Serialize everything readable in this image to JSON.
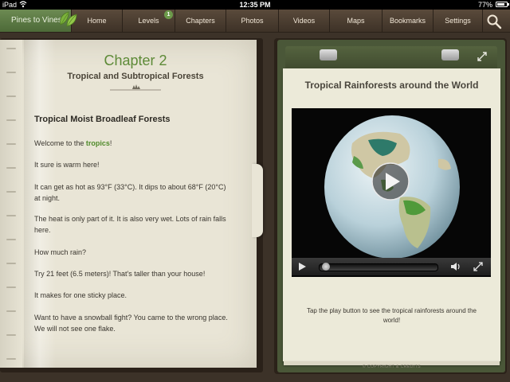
{
  "status": {
    "device": "iPad",
    "time": "12:35 PM",
    "battery": "77%",
    "battery_level": 0.77
  },
  "nav": {
    "brand": "Pines to Vines",
    "items": [
      {
        "label": "Home"
      },
      {
        "label": "Levels",
        "badge": "1"
      },
      {
        "label": "Chapters"
      },
      {
        "label": "Photos"
      },
      {
        "label": "Videos"
      },
      {
        "label": "Maps"
      },
      {
        "label": "Bookmarks"
      },
      {
        "label": "Settings"
      }
    ],
    "search_icon": "search-icon"
  },
  "book": {
    "chapter_title": "Chapter 2",
    "chapter_subtitle": "Tropical and Subtropical Forests",
    "section_heading": "Tropical Moist Broadleaf Forests",
    "p1_before": "Welcome to the ",
    "p1_highlight": "tropics",
    "p1_after": "!",
    "p2": "It sure is warm here!",
    "p3": "It can get as hot as 93°F (33°C). It dips to about 68°F (20°C) at night.",
    "p4": "The heat is only part of it. It is also very wet. Lots of rain falls here.",
    "p5": "How much rain?",
    "p6": "Try 21 feet (6.5 meters)! That's taller than your house!",
    "p7": "It makes for one sticky place.",
    "p8": "Want to have a snowball fight? You came to the wrong place. We will not see one flake.",
    "highlight_color": "#4f8a2a"
  },
  "media": {
    "title": "Tropical Rainforests around the World",
    "caption": "Tap the play button to see the tropical rainforests around the world!",
    "copyright": "© COPYRIGHT & CREDITS",
    "progress": 0.0
  }
}
